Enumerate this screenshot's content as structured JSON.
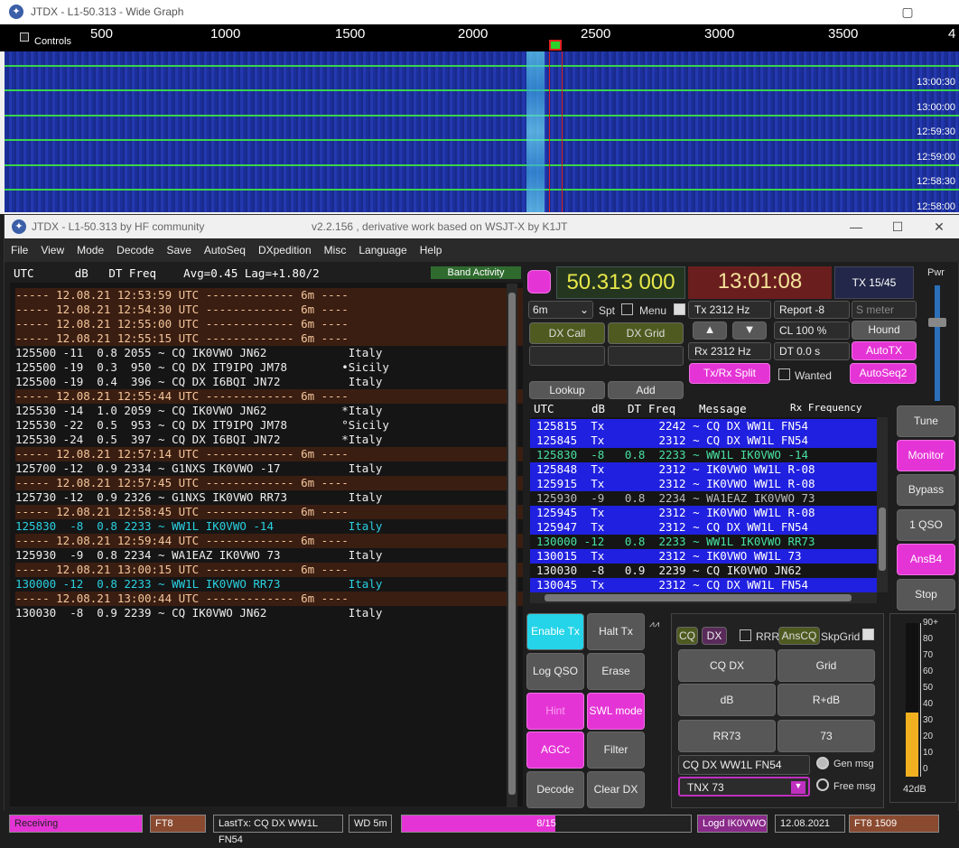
{
  "wide_graph": {
    "title": "JTDX - L1-50.313 - Wide Graph",
    "controls_label": "Controls",
    "scale_ticks": [
      "500",
      "1000",
      "1500",
      "2000",
      "2500",
      "3000",
      "3500",
      "4"
    ],
    "times": [
      "13:00:30",
      "13:00:00",
      "12:59:30",
      "12:59:00",
      "12:58:30",
      "12:58:00"
    ],
    "band": "6m"
  },
  "main": {
    "title": "JTDX - L1-50.313  by HF community",
    "subtitle": "v2.2.156 , derivative work based on WSJT-X by K1JT",
    "menu": [
      "File",
      "View",
      "Mode",
      "Decode",
      "Save",
      "AutoSeq",
      "DXpedition",
      "Misc",
      "Language",
      "Help"
    ],
    "left_header": "UTC      dB   DT Freq    Avg=0.45 Lag=+1.80/2",
    "band_activity": "Band Activity",
    "decodes": [
      {
        "t": "----- 12.08.21 12:53:59 UTC ------------- 6m ----",
        "k": "sep"
      },
      {
        "t": "----- 12.08.21 12:54:30 UTC ------------- 6m ----",
        "k": "sep"
      },
      {
        "t": "----- 12.08.21 12:55:00 UTC ------------- 6m ----",
        "k": "sep"
      },
      {
        "t": "----- 12.08.21 12:55:15 UTC ------------- 6m ----",
        "k": "sep"
      },
      {
        "t": "125500 -11  0.8 2055 ~ CQ IK0VWO JN62            Italy",
        "k": "n"
      },
      {
        "t": "125500 -19  0.3  950 ~ CQ DX IT9IPQ JM78        •Sicily",
        "k": "n"
      },
      {
        "t": "125500 -19  0.4  396 ~ CQ DX I6BQI JN72          Italy",
        "k": "n"
      },
      {
        "t": "----- 12.08.21 12:55:44 UTC ------------- 6m ----",
        "k": "sep"
      },
      {
        "t": "125530 -14  1.0 2059 ~ CQ IK0VWO JN62           *Italy",
        "k": "n"
      },
      {
        "t": "125530 -22  0.5  953 ~ CQ DX IT9IPQ JM78        °Sicily",
        "k": "n"
      },
      {
        "t": "125530 -24  0.5  397 ~ CQ DX I6BQI JN72         *Italy",
        "k": "n"
      },
      {
        "t": "----- 12.08.21 12:57:14 UTC ------------- 6m ----",
        "k": "sep"
      },
      {
        "t": "125700 -12  0.9 2334 ~ G1NXS IK0VWO -17          Italy",
        "k": "n"
      },
      {
        "t": "----- 12.08.21 12:57:45 UTC ------------- 6m ----",
        "k": "sep"
      },
      {
        "t": "125730 -12  0.9 2326 ~ G1NXS IK0VWO RR73         Italy",
        "k": "n"
      },
      {
        "t": "----- 12.08.21 12:58:45 UTC ------------- 6m ----",
        "k": "sep"
      },
      {
        "t": "125830  -8  0.8 2233 ~ WW1L IK0VWO -14           Italy",
        "k": "c"
      },
      {
        "t": "----- 12.08.21 12:59:44 UTC ------------- 6m ----",
        "k": "sep"
      },
      {
        "t": "125930  -9  0.8 2234 ~ WA1EAZ IK0VWO 73          Italy",
        "k": "n"
      },
      {
        "t": "----- 12.08.21 13:00:15 UTC ------------- 6m ----",
        "k": "sep"
      },
      {
        "t": "130000 -12  0.8 2233 ~ WW1L IK0VWO RR73          Italy",
        "k": "c"
      },
      {
        "t": "----- 12.08.21 13:00:44 UTC ------------- 6m ----",
        "k": "sep"
      },
      {
        "t": "130030  -8  0.9 2239 ~ CQ IK0VWO JN62            Italy",
        "k": "n"
      }
    ],
    "freq": "50.313 000",
    "clock": "13:01:08",
    "tx_period": "TX 15/45",
    "pwr": "Pwr",
    "band_select": "6m",
    "spt": "Spt",
    "menu_chk": "Menu",
    "tx_hz": "Tx  2312  Hz",
    "rx_hz": "Rx  2312  Hz",
    "report": "Report -8",
    "smeter": "S meter",
    "cl": "CL  100 %",
    "dt": "DT 0.0 s",
    "hound": "Hound",
    "autotx": "AutoTX",
    "autoseq2": "AutoSeq2",
    "dx_call": "DX Call",
    "dx_grid": "DX Grid",
    "txrx_split": "Tx/Rx Split",
    "wanted": "Wanted",
    "lookup": "Lookup",
    "add": "Add",
    "right_header": [
      "UTC",
      "dB",
      "DT",
      "Freq",
      "Message",
      "Rx Frequency"
    ],
    "qso": [
      {
        "t": "125815  Tx        2242 ~ CQ DX WW1L FN54",
        "k": "tx"
      },
      {
        "t": "125845  Tx        2312 ~ CQ DX WW1L FN54",
        "k": "tx"
      },
      {
        "t": "125830  -8   0.8  2233 ~ WW1L IK0VWO -14",
        "k": "rx"
      },
      {
        "t": "125848  Tx        2312 ~ IK0VWO WW1L R-08",
        "k": "tx"
      },
      {
        "t": "125915  Tx        2312 ~ IK0VWO WW1L R-08",
        "k": "tx"
      },
      {
        "t": "125930  -9   0.8  2234 ~ WA1EAZ IK0VWO 73",
        "k": "g"
      },
      {
        "t": "125945  Tx        2312 ~ IK0VWO WW1L R-08",
        "k": "tx"
      },
      {
        "t": "125947  Tx        2312 ~ CQ DX WW1L FN54",
        "k": "tx"
      },
      {
        "t": "130000 -12   0.8  2233 ~ WW1L IK0VWO RR73",
        "k": "rx"
      },
      {
        "t": "130015  Tx        2312 ~ IK0VWO WW1L 73",
        "k": "tx"
      },
      {
        "t": "130030  -8   0.9  2239 ~ CQ IK0VWO JN62",
        "k": "n"
      },
      {
        "t": "130045  Tx        2312 ~ CQ DX WW1L FN54",
        "k": "tx"
      }
    ],
    "side_buttons": [
      "Tune",
      "Monitor",
      "Bypass",
      "1 QSO",
      "AnsB4",
      "Stop"
    ],
    "bottom_buttons": [
      "Enable Tx",
      "Halt Tx",
      "Log QSO",
      "Erase",
      "Hint",
      "SWL mode",
      "AGCc",
      "Filter",
      "Decode",
      "Clear DX"
    ],
    "cq": "CQ",
    "dx": "DX",
    "rrr": "RRR",
    "anscq": "AnsCQ",
    "skpgrid": "SkpGrid",
    "msg_buttons": [
      "CQ DX",
      "Grid",
      "dB",
      "R+dB",
      "RR73",
      "73"
    ],
    "tx_msg": "CQ DX WW1L FN54",
    "gen_msg": "Gen msg",
    "free_msg_value": "TNX 73",
    "free_msg": "Free msg",
    "meter_ticks": [
      "90+",
      "80",
      "70",
      "60",
      "50",
      "40",
      "30",
      "20",
      "10",
      "0"
    ],
    "meter_db": "42dB",
    "meter_level": 0.42
  },
  "status": {
    "receiving": "Receiving",
    "mode": "FT8",
    "last_tx": "LastTx: CQ DX WW1L FN54",
    "wd": "WD 5m",
    "progress": "8/15",
    "progress_frac": 0.53,
    "logd": "Logd IK0VWO",
    "date": "12.08.2021",
    "ft8": "FT8  1509"
  }
}
